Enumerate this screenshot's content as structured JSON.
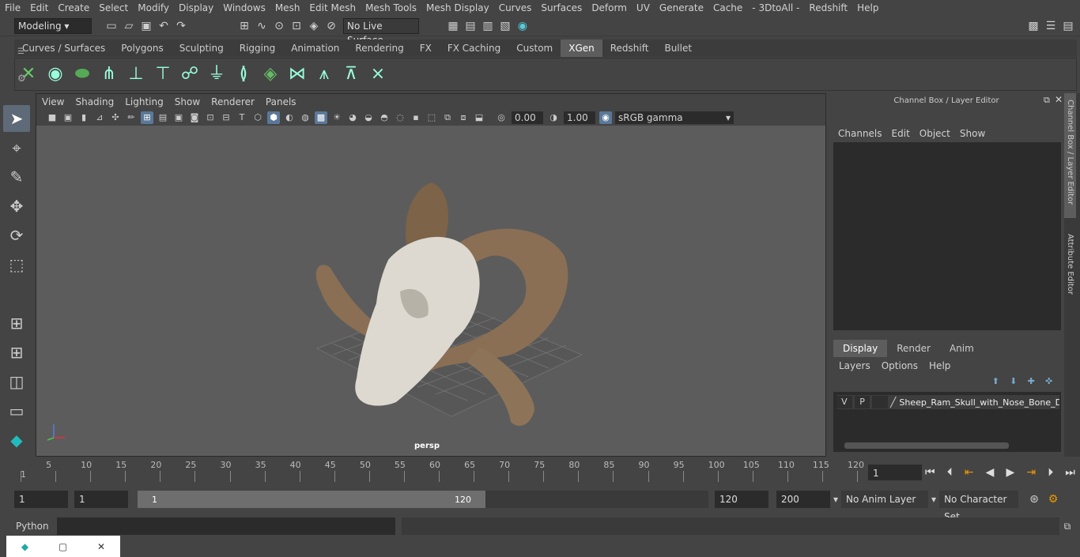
{
  "menubar": [
    "File",
    "Edit",
    "Create",
    "Select",
    "Modify",
    "Display",
    "Windows",
    "Mesh",
    "Edit Mesh",
    "Mesh Tools",
    "Mesh Display",
    "Curves",
    "Surfaces",
    "Deform",
    "UV",
    "Generate",
    "Cache",
    "- 3DtoAll -",
    "Redshift",
    "Help"
  ],
  "status": {
    "mode": "Modeling",
    "live_surface": "No Live Surface"
  },
  "shelf_tabs": [
    "Curves / Surfaces",
    "Polygons",
    "Sculpting",
    "Rigging",
    "Animation",
    "Rendering",
    "FX",
    "FX Caching",
    "Custom",
    "XGen",
    "Redshift",
    "Bullet"
  ],
  "shelf_active": "XGen",
  "viewport": {
    "menu": [
      "View",
      "Shading",
      "Lighting",
      "Show",
      "Renderer",
      "Panels"
    ],
    "exposure": "0.00",
    "gamma": "1.00",
    "colorspace": "sRGB gamma",
    "camera": "persp"
  },
  "channel_box": {
    "title": "Channel Box / Layer Editor",
    "menu": [
      "Channels",
      "Edit",
      "Object",
      "Show"
    ],
    "display_tabs": [
      "Display",
      "Render",
      "Anim"
    ],
    "display_active": "Display",
    "layer_menu": [
      "Layers",
      "Options",
      "Help"
    ],
    "layer": {
      "v": "V",
      "p": "P",
      "name": "Sheep_Ram_Skull_with_Nose_Bone_D"
    }
  },
  "side_tabs": [
    "Channel Box / Layer Editor",
    "Attribute Editor"
  ],
  "timeline": {
    "ticks": [
      1,
      5,
      10,
      15,
      20,
      25,
      30,
      35,
      40,
      45,
      50,
      55,
      60,
      65,
      70,
      75,
      80,
      85,
      90,
      95,
      100,
      105,
      110,
      115,
      120
    ],
    "current": "1"
  },
  "range": {
    "start": "1",
    "playback_start": "1",
    "slider_start": "1",
    "slider_end": "120",
    "end": "120",
    "anim_end": "200",
    "anim_layer": "No Anim Layer",
    "char_set": "No Character Set"
  },
  "cmdline": {
    "label": "Python"
  }
}
